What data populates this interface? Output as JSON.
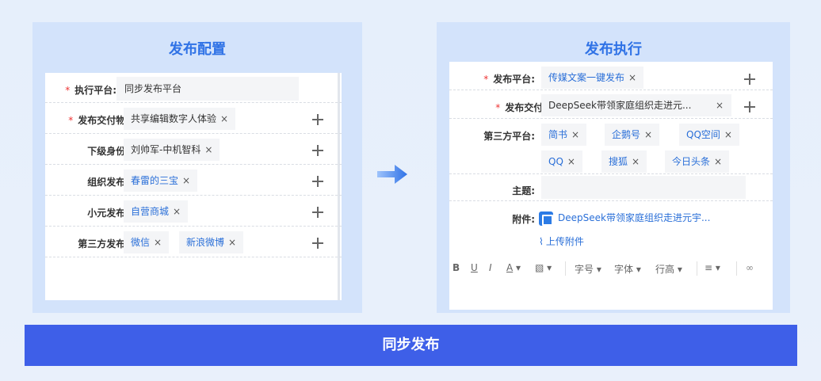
{
  "left_panel": {
    "title": "发布配置",
    "rows": [
      {
        "label": "执行平台:",
        "required": true,
        "value": "同步发布平台"
      },
      {
        "label": "发布交付物:",
        "required": true,
        "tags": [
          "共享编辑数字人体验"
        ]
      },
      {
        "label": "下级身份:",
        "required": false,
        "tags": [
          "刘帅军-中机智科"
        ]
      },
      {
        "label": "组织发布:",
        "required": false,
        "tags": [
          "春雷的三宝"
        ]
      },
      {
        "label": "小元发布:",
        "required": false,
        "tags": [
          "自营商城"
        ]
      },
      {
        "label": "第三方发布:",
        "required": false,
        "tags": [
          "微信",
          "新浪微博"
        ]
      }
    ]
  },
  "right_panel": {
    "title": "发布执行",
    "platform_label": "发布平台:",
    "platform_tag": "传媒文案一键发布",
    "deliverable_label": "发布交付物:",
    "deliverable_tag": "DeepSeek带领家庭组织走进元...",
    "third_party_label": "第三方平台:",
    "third_party_tags": [
      "简书",
      "企鹅号",
      "QQ空间",
      "QQ",
      "搜狐",
      "今日头条"
    ],
    "subject_label": "主题:",
    "subject_value": "",
    "attachment_label": "附件:",
    "attachment_file": "DeepSeek带领家庭组织走进元宇...",
    "upload_label": "上传附件",
    "toolbar": {
      "bold": "B",
      "underline": "U",
      "italic": "I",
      "font_color": "A",
      "bg_color": "▧",
      "font_size": "字号",
      "font_family": "字体",
      "line_height": "行高",
      "align": "≡",
      "link": "🔗"
    }
  },
  "bottom_bar": {
    "label": "同步发布"
  },
  "close_symbol": "×",
  "colors": {
    "accent_blue": "#2f72e6",
    "bar_blue": "#3e5fe8",
    "panel_bg": "#d3e3fb",
    "required_red": "#ee3333"
  }
}
